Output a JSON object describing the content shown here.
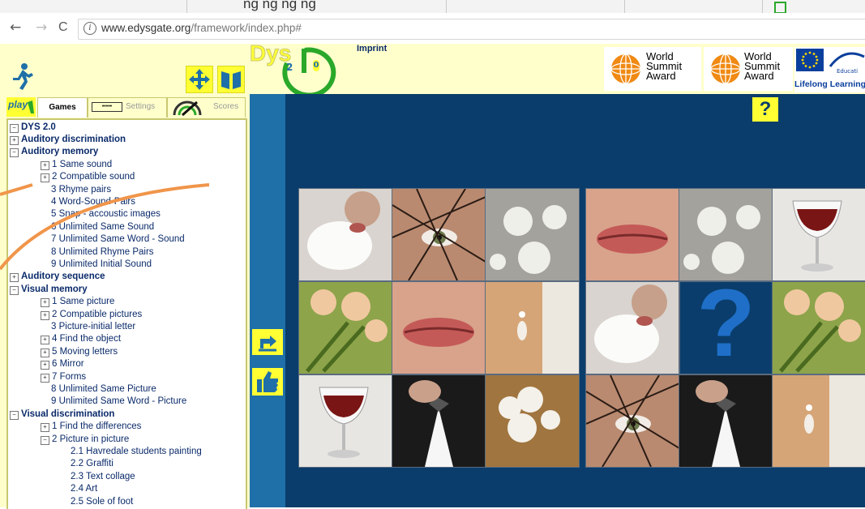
{
  "browser": {
    "tab_strip_text": "ng     ng ng     ng",
    "url_host": "www.edysgate.org",
    "url_path": "/framework/index.php#",
    "back_glyph": "←",
    "forward_glyph": "→",
    "reload_glyph": "C",
    "info_glyph": "i"
  },
  "banner": {
    "logo_text": "Dys",
    "logo_version_left": "2",
    "logo_version_right": "0",
    "imprint_label": "Imprint",
    "award1_line1": "World",
    "award1_line2": "Summit",
    "award1_line3": "Award",
    "award2_line1": "World",
    "award2_line2": "Summit",
    "award2_line3": "Award",
    "eu_text": "Educati",
    "llp_text": "Lifelong Learning P",
    "colors": {
      "banner_bg": "#ffffcc",
      "logo_green": "#2aa82a",
      "brand_yellow": "#ffff33"
    }
  },
  "tabs": {
    "play_label": "play",
    "games_label": "Games",
    "settings_label": "Settings",
    "scores_label": "Scores",
    "settings_dots": "•••••"
  },
  "tree": {
    "root": "DYS 2.0",
    "items": [
      {
        "label": "Auditory discrimination",
        "level": 1,
        "expander": "+",
        "bold": true
      },
      {
        "label": "Auditory memory",
        "level": 1,
        "expander": "−",
        "bold": true
      },
      {
        "label": "1 Same sound",
        "level": 2,
        "expander": "+"
      },
      {
        "label": "2 Compatible sound",
        "level": 2,
        "expander": "+"
      },
      {
        "label": "3 Rhyme pairs",
        "level": 2,
        "expander": ""
      },
      {
        "label": "4 Word-Sound-Pairs",
        "level": 2,
        "expander": ""
      },
      {
        "label": "5 Snap - accoustic images",
        "level": 2,
        "expander": ""
      },
      {
        "label": "6 Unlimited Same Sound",
        "level": 2,
        "expander": ""
      },
      {
        "label": "7 Unlimited Same Word - Sound",
        "level": 2,
        "expander": ""
      },
      {
        "label": "8 Unlimited Rhyme Pairs",
        "level": 2,
        "expander": ""
      },
      {
        "label": "9 Unlimited Initial Sound",
        "level": 2,
        "expander": ""
      },
      {
        "label": "Auditory sequence",
        "level": 1,
        "expander": "+",
        "bold": true
      },
      {
        "label": "Visual memory",
        "level": 1,
        "expander": "−",
        "bold": true
      },
      {
        "label": "1 Same picture",
        "level": 2,
        "expander": "+"
      },
      {
        "label": "2 Compatible pictures",
        "level": 2,
        "expander": "+"
      },
      {
        "label": "3 Picture-initial letter",
        "level": 2,
        "expander": ""
      },
      {
        "label": "4 Find the object",
        "level": 2,
        "expander": "+"
      },
      {
        "label": "5 Moving letters",
        "level": 2,
        "expander": "+"
      },
      {
        "label": "6 Mirror",
        "level": 2,
        "expander": "+"
      },
      {
        "label": "7 Forms",
        "level": 2,
        "expander": "+"
      },
      {
        "label": "8 Unlimited Same Picture",
        "level": 2,
        "expander": ""
      },
      {
        "label": "9 Unlimited Same Word - Picture",
        "level": 2,
        "expander": ""
      },
      {
        "label": "Visual discrimination",
        "level": 1,
        "expander": "−",
        "bold": true
      },
      {
        "label": "1 Find the differences",
        "level": 2,
        "expander": "+"
      },
      {
        "label": "2 Picture in picture",
        "level": 2,
        "expander": "−"
      },
      {
        "label": "2.1 Havredale students painting",
        "level": 3,
        "expander": ""
      },
      {
        "label": "2.2 Graffiti",
        "level": 3,
        "expander": ""
      },
      {
        "label": "2.3 Text collage",
        "level": 3,
        "expander": ""
      },
      {
        "label": "2.4 Art",
        "level": 3,
        "expander": ""
      },
      {
        "label": "2.5 Sole of foot",
        "level": 3,
        "expander": ""
      }
    ]
  },
  "toolbar": {
    "help_label": "?",
    "undo_icon": "undo-icon",
    "thumbs_icon": "thumbs-up-icon"
  },
  "memory_cards": {
    "left_grid": [
      "glove-kiss",
      "veil-eye",
      "lace-flowers",
      "bouquet",
      "lips",
      "pearl-earring",
      "wine-glass",
      "tuxedo-tie",
      "lace-hair"
    ],
    "right_grid": [
      "lips",
      "lace-flowers",
      "wine-glass",
      "glove-kiss",
      "question-mark",
      "bouquet",
      "veil-eye",
      "tuxedo-tie",
      "pearl-earring"
    ],
    "question_glyph": "?"
  }
}
